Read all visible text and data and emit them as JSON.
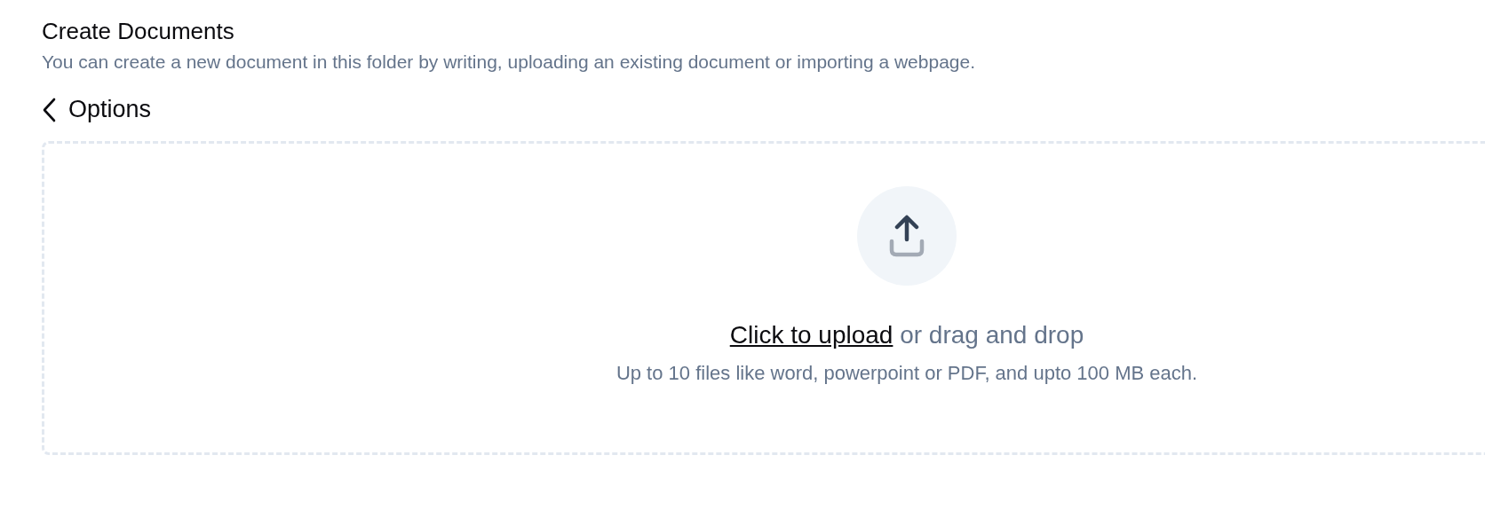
{
  "header": {
    "title": "Create Documents",
    "description": "You can create a new document in this folder by writing, uploading an existing document or importing a webpage."
  },
  "back": {
    "label": "Options"
  },
  "upload": {
    "link": "Click to upload",
    "rest": "or drag and drop",
    "hint": "Up to 10 files like word, powerpoint or PDF, and upto 100 MB each."
  }
}
